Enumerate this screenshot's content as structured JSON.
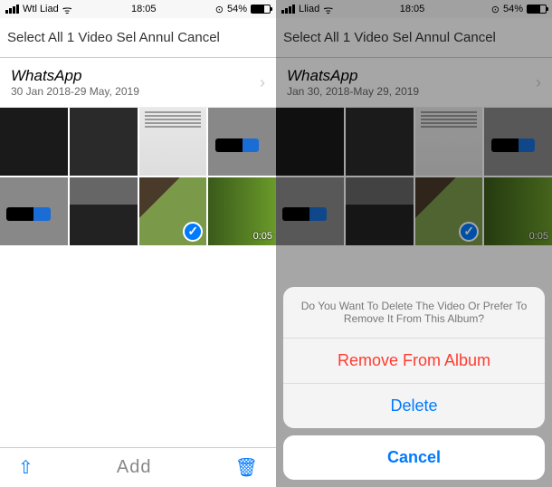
{
  "left": {
    "status": {
      "carrier": "Wtl Liad",
      "time": "18:05",
      "battery": "54%"
    },
    "nav": "Select All 1 Video Sel Annul Cancel",
    "album": {
      "title": "WhatsApp",
      "date": "30 Jan 2018-29 May, 2019"
    },
    "video_duration": "0:05",
    "toolbar": {
      "add": "Add"
    }
  },
  "right": {
    "status": {
      "carrier": "Lliad",
      "time": "18:05",
      "battery": "54%"
    },
    "nav": "Select All 1 Video Sel Annul Cancel",
    "album": {
      "title": "WhatsApp",
      "date": "Jan 30, 2018-May 29, 2019"
    },
    "video_duration": "0:05",
    "sheet": {
      "message": "Do You Want To Delete The Video Or Prefer To Remove It From This Album?",
      "remove": "Remove From Album",
      "delete": "Delete",
      "cancel": "Cancel"
    }
  }
}
